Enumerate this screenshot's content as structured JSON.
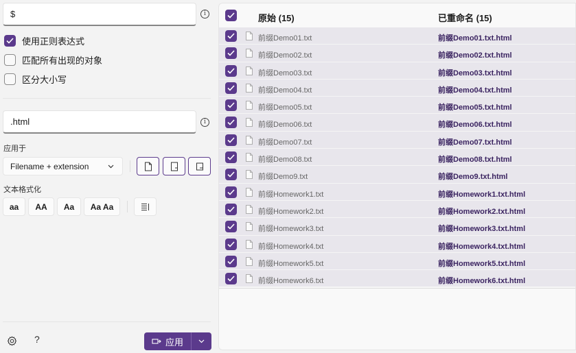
{
  "search": {
    "value": "$"
  },
  "options": [
    {
      "label": "使用正则表达式",
      "checked": true
    },
    {
      "label": "匹配所有出现的对象",
      "checked": false
    },
    {
      "label": "区分大小写",
      "checked": false
    }
  ],
  "replace": {
    "value": ".html"
  },
  "apply_to": {
    "label": "应用于",
    "selected": "Filename + extension"
  },
  "text_format": {
    "label": "文本格式化",
    "buttons": [
      "aa",
      "AA",
      "Aa",
      "Aa Aa"
    ]
  },
  "apply_button": {
    "label": "应用"
  },
  "footer": {
    "help": "?"
  },
  "table": {
    "header_original": "原始 (15)",
    "header_renamed": "已重命名 (15)",
    "rows": [
      {
        "original": "前缀Demo01.txt",
        "renamed": "前缀Demo01.txt.html"
      },
      {
        "original": "前缀Demo02.txt",
        "renamed": "前缀Demo02.txt.html"
      },
      {
        "original": "前缀Demo03.txt",
        "renamed": "前缀Demo03.txt.html"
      },
      {
        "original": "前缀Demo04.txt",
        "renamed": "前缀Demo04.txt.html"
      },
      {
        "original": "前缀Demo05.txt",
        "renamed": "前缀Demo05.txt.html"
      },
      {
        "original": "前缀Demo06.txt",
        "renamed": "前缀Demo06.txt.html"
      },
      {
        "original": "前缀Demo07.txt",
        "renamed": "前缀Demo07.txt.html"
      },
      {
        "original": "前缀Demo08.txt",
        "renamed": "前缀Demo08.txt.html"
      },
      {
        "original": "前缀Demo9.txt",
        "renamed": "前缀Demo9.txt.html"
      },
      {
        "original": "前缀Homework1.txt",
        "renamed": "前缀Homework1.txt.html"
      },
      {
        "original": "前缀Homework2.txt",
        "renamed": "前缀Homework2.txt.html"
      },
      {
        "original": "前缀Homework3.txt",
        "renamed": "前缀Homework3.txt.html"
      },
      {
        "original": "前缀Homework4.txt",
        "renamed": "前缀Homework4.txt.html"
      },
      {
        "original": "前缀Homework5.txt",
        "renamed": "前缀Homework5.txt.html"
      },
      {
        "original": "前缀Homework6.txt",
        "renamed": "前缀Homework6.txt.html"
      }
    ]
  },
  "colors": {
    "accent": "#5b3a8c",
    "row_bg": "#e8e6ec",
    "renamed_text": "#3b2461"
  }
}
